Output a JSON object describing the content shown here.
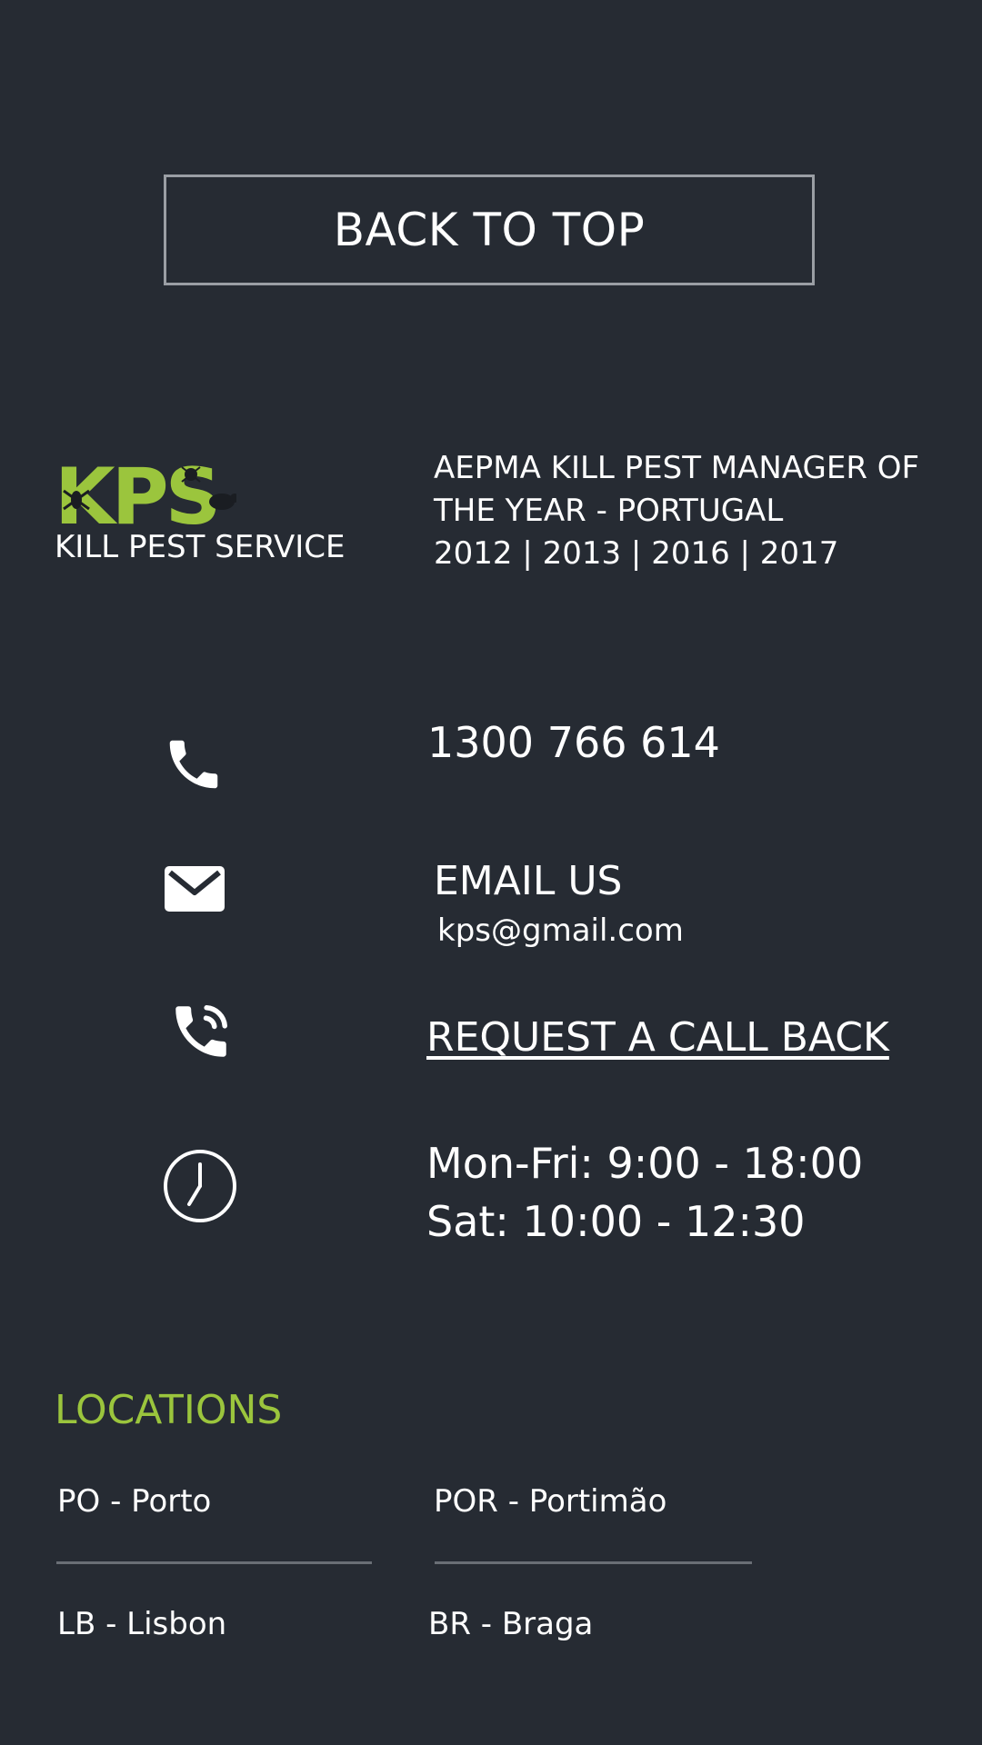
{
  "back_to_top": {
    "label": "BACK TO TOP"
  },
  "brand": {
    "logo_text": "KPS",
    "name": "KILL PEST SERVICE",
    "logo_color": "#9bc53d"
  },
  "award": {
    "lines": [
      "AEPMA KILL PEST MANAGER OF",
      "THE YEAR - PORTUGAL",
      "2012 | 2013 | 2016 | 2017"
    ]
  },
  "contact": {
    "phone": {
      "icon": "phone-icon",
      "number": "1300 766 614"
    },
    "email": {
      "icon": "mail-icon",
      "title": "EMAIL US",
      "address": "kps@gmail.com"
    },
    "callback": {
      "icon": "phone-callback-icon",
      "label": "REQUEST A CALL BACK"
    },
    "hours": {
      "icon": "clock-icon",
      "weekdays": "Mon-Fri: 9:00 - 18:00",
      "saturday": "Sat: 10:00 - 12:30"
    }
  },
  "locations": {
    "title": "LOCATIONS",
    "title_color": "#9bc53d",
    "items": [
      "PO - Porto",
      "POR - Portimão",
      "LB - Lisbon",
      "BR - Braga"
    ]
  }
}
